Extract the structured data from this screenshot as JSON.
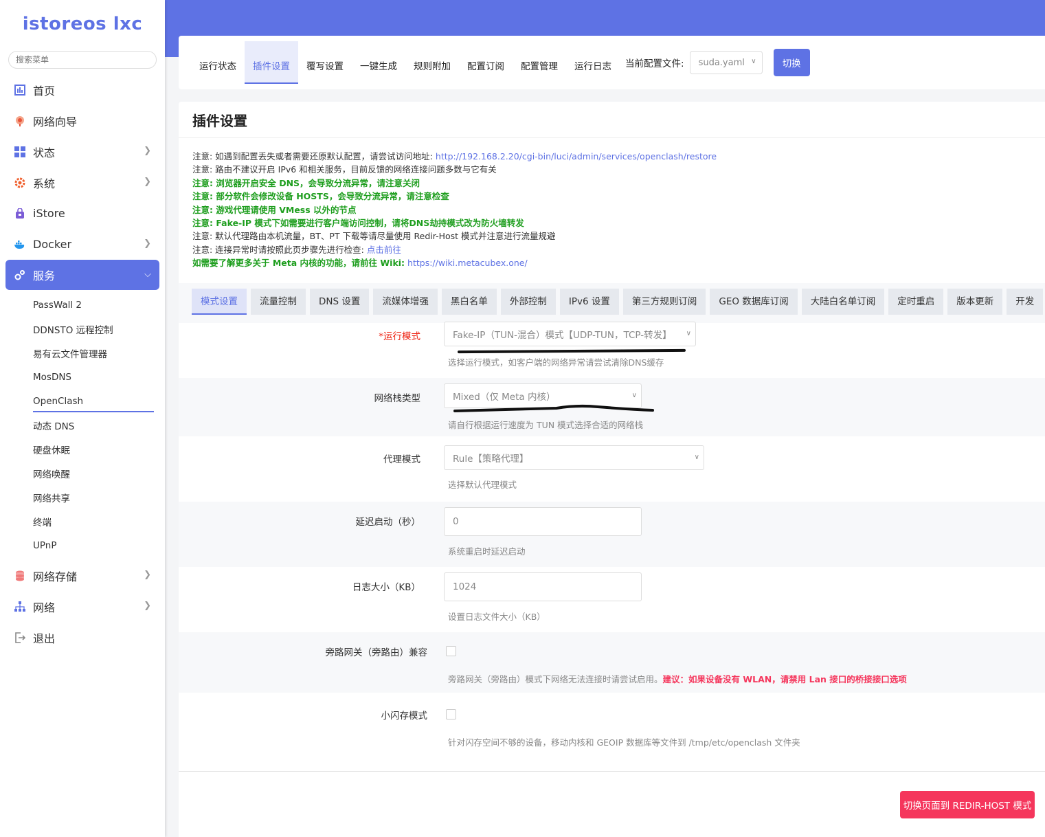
{
  "sidebar": {
    "logo": "istoreos lxc",
    "search_placeholder": "搜索菜单",
    "items": [
      {
        "label": "首页",
        "icon": "dashboard-icon"
      },
      {
        "label": "网络向导",
        "icon": "globe-icon"
      },
      {
        "label": "状态",
        "icon": "grid-icon"
      },
      {
        "label": "系统",
        "icon": "gear-icon"
      },
      {
        "label": "iStore",
        "icon": "store-icon"
      },
      {
        "label": "Docker",
        "icon": "docker-icon"
      },
      {
        "label": "服务",
        "icon": "services-icon"
      },
      {
        "label": "网络存储",
        "icon": "database-icon"
      },
      {
        "label": "网络",
        "icon": "network-icon"
      },
      {
        "label": "退出",
        "icon": "logout-icon"
      }
    ],
    "sub_items": [
      "PassWall 2",
      "DDNSTO 远程控制",
      "易有云文件管理器",
      "MosDNS",
      "OpenClash",
      "动态 DNS",
      "硬盘休眠",
      "网络唤醒",
      "网络共享",
      "终端",
      "UPnP"
    ]
  },
  "top_tabs": [
    "运行状态",
    "插件设置",
    "覆写设置",
    "一键生成",
    "规则附加",
    "配置订阅",
    "配置管理",
    "运行日志"
  ],
  "config": {
    "label": "当前配置文件:",
    "value": "suda.yaml",
    "switch": "切换"
  },
  "page_title": "插件设置",
  "notes": {
    "n1": "注意: 如遇到配置丢失或者需要还原默认配置，请尝试访问地址:",
    "n1_link": "http://192.168.2.20/cgi-bin/luci/admin/services/openclash/restore",
    "n2": "注意: 路由不建议开启 IPv6 和相关服务，目前反馈的网络连接问题多数与它有关",
    "n3": "注意: 浏览器开启安全 DNS，会导致分流异常，请注意关闭",
    "n4": "注意: 部分软件会修改设备 HOSTS，会导致分流异常，请注意检查",
    "n5": "注意: 游戏代理请使用 VMess 以外的节点",
    "n6": "注意: Fake-IP 模式下如需要进行客户端访问控制，请将DNS劫持模式改为防火墙转发",
    "n7": "注意: 默认代理路由本机流量，BT、PT 下载等请尽量使用 Redir-Host 模式并注意进行流量规避",
    "n8": "注意: 连接异常时请按照此页步骤先进行检查:",
    "n8_link": "点击前往",
    "n9": "如需要了解更多关于 Meta 内核的功能，请前往 Wiki:",
    "n9_link": "https://wiki.metacubex.one/"
  },
  "sub_tabs": [
    "模式设置",
    "流量控制",
    "DNS 设置",
    "流媒体增强",
    "黑白名单",
    "外部控制",
    "IPv6 设置",
    "第三方规则订阅",
    "GEO 数据库订阅",
    "大陆白名单订阅",
    "定时重启",
    "版本更新",
    "开发"
  ],
  "form": {
    "run_mode": {
      "req": "*",
      "label": "运行模式",
      "value": "Fake-IP（TUN-混合）模式【UDP-TUN，TCP-转发】",
      "hint": "选择运行模式，如客户端的网络异常请尝试清除DNS缓存"
    },
    "stack": {
      "label": "网络栈类型",
      "value": "Mixed（仅 Meta 内核）",
      "hint": "请自行根据运行速度为 TUN 模式选择合适的网络栈"
    },
    "proxy_mode": {
      "label": "代理模式",
      "value": "Rule【策略代理】",
      "hint": "选择默认代理模式"
    },
    "delay": {
      "label": "延迟启动（秒）",
      "value": "0",
      "hint": "系统重启时延迟启动"
    },
    "log_size": {
      "label": "日志大小（KB）",
      "value": "1024",
      "hint": "设置日志文件大小（KB）"
    },
    "bypass": {
      "label": "旁路网关（旁路由）兼容",
      "hint": "旁路网关（旁路由）模式下网络无法连接时请尝试启用。",
      "hint_red": "建议：如果设备没有 WLAN，请禁用 Lan 接口的桥接接口选项",
      "checked": false
    },
    "small_flash": {
      "label": "小闪存模式",
      "hint": "针对闪存空间不够的设备，移动内核和 GEOIP 数据库等文件到 /tmp/etc/openclash 文件夹",
      "checked": false
    }
  },
  "redir_button": "切换页面到 REDIR-HOST 模式",
  "colors": {
    "accent": "#5e72e4",
    "danger": "#f5365c",
    "green": "#1e9e1e"
  }
}
